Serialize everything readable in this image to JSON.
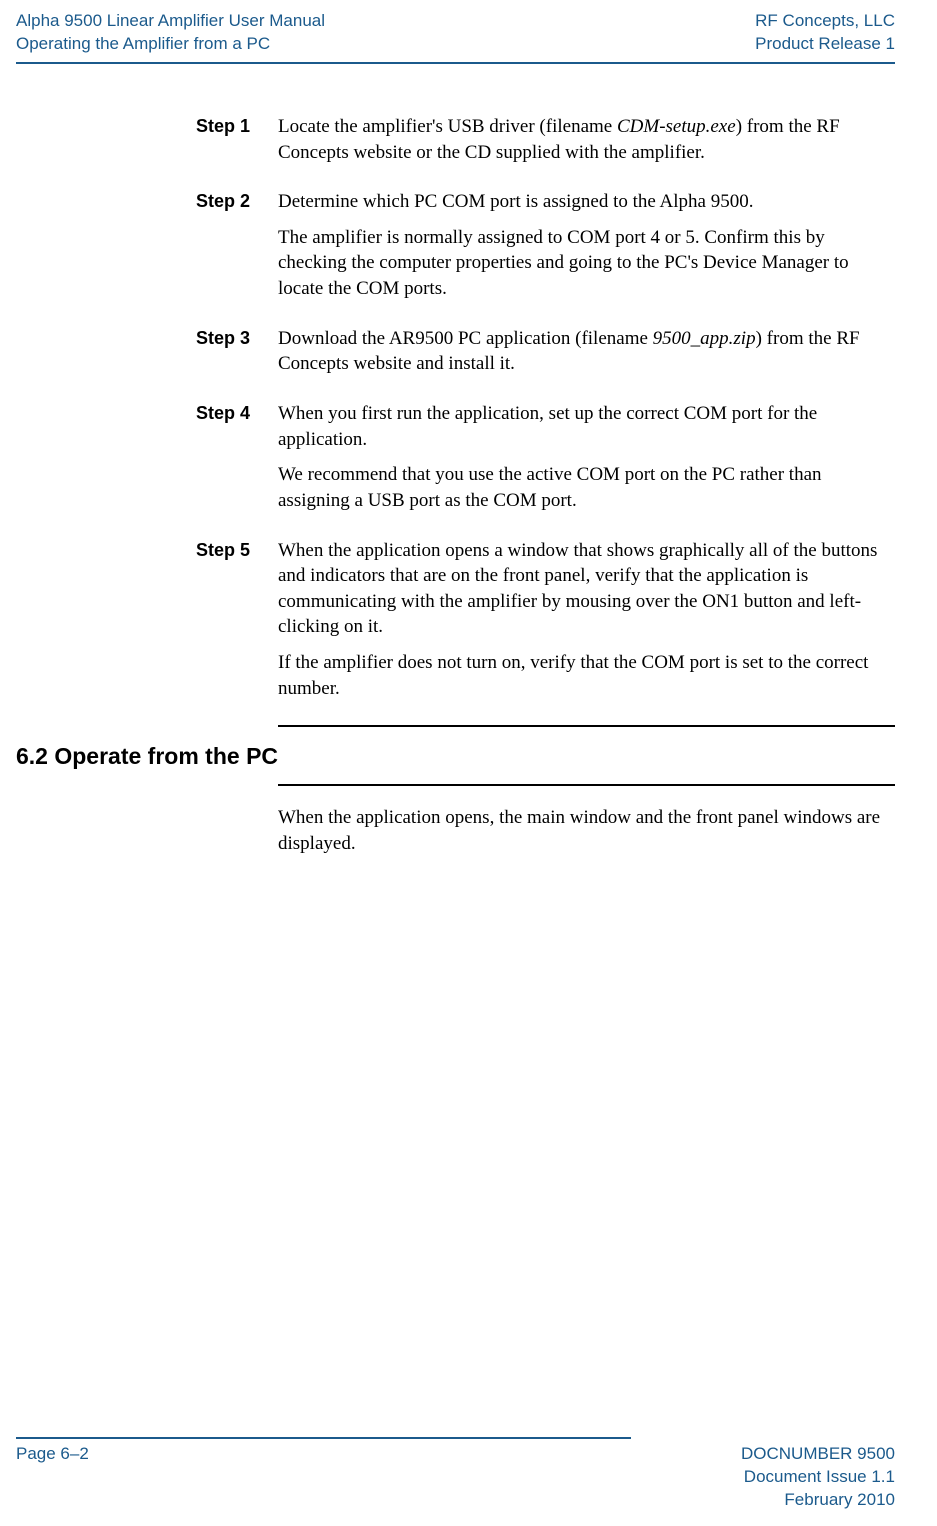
{
  "header": {
    "left_line1": "Alpha 9500 Linear Amplifier User Manual",
    "left_line2": "Operating the Amplifier from a PC",
    "right_line1": "RF Concepts, LLC",
    "right_line2": "Product Release 1"
  },
  "steps": [
    {
      "label": "Step 1",
      "paras": [
        "Locate the amplifier's USB driver (filename <i>CDM-setup.exe</i>) from the RF Concepts website or the CD supplied with the amplifier."
      ]
    },
    {
      "label": "Step 2",
      "paras": [
        "Determine which PC COM port is assigned to the Alpha 9500.",
        "The amplifier is normally assigned to COM port 4 or 5. Confirm this by checking the computer properties and going to the PC's Device Manager to locate the COM ports."
      ]
    },
    {
      "label": "Step 3",
      "paras": [
        "Download the AR9500 PC application (filename <i>9500_app.zip</i>) from the RF Concepts website and install it."
      ]
    },
    {
      "label": "Step 4",
      "paras": [
        "When you first run the application, set up the correct COM port for the application.",
        "We recommend that you use the active COM port on the PC rather than assigning a USB port as the COM port."
      ]
    },
    {
      "label": "Step 5",
      "paras": [
        "When the application opens a window that shows graphically all of the buttons and indicators that are on the front panel, verify that the application is communicating with the amplifier by mousing over the ON1 button and left-clicking on it.",
        "If the amplifier does not turn on, verify that the COM port is set to the correct number."
      ]
    }
  ],
  "section": {
    "heading": "6.2  Operate from the PC",
    "intro": "When the application opens, the main window and the front panel windows are displayed."
  },
  "footer": {
    "page": "Page 6–2",
    "docnum": "DOCNUMBER 9500",
    "issue": "Document Issue 1.1",
    "date": "February 2010"
  }
}
